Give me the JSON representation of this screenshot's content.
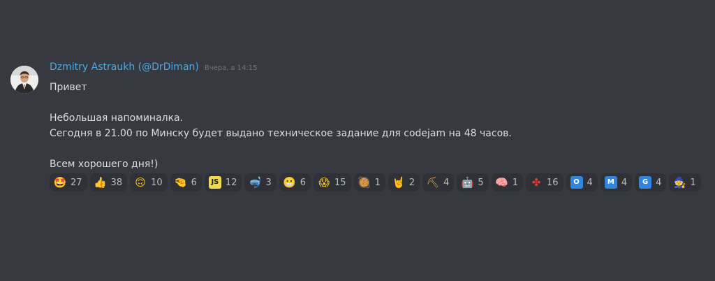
{
  "message": {
    "author": "Dzmitry Astraukh (@DrDiman)",
    "timestamp": "Вчера, в 14:15",
    "lines": [
      "Привет",
      "",
      "Небольшая напоминалка.",
      "Сегодня в 21.00 по Минску будет выдано техническое задание для codejam на 48 часов.",
      "",
      "Всем хорошего дня!)"
    ]
  },
  "reactions": [
    {
      "name": "star-struck",
      "glyph": "🤩",
      "count": "27",
      "bg": "transparent",
      "color": "#f7c72b"
    },
    {
      "name": "thumbs-up",
      "glyph": "👍",
      "count": "38",
      "bg": "transparent",
      "color": "#f7c72b"
    },
    {
      "name": "upside-down-face",
      "glyph": "🙃",
      "count": "10",
      "bg": "transparent",
      "color": "#f7c72b"
    },
    {
      "name": "pinching-hand",
      "glyph": "🤏",
      "count": "6",
      "bg": "transparent",
      "color": "#f7c72b"
    },
    {
      "name": "js",
      "glyph": "JS",
      "count": "12",
      "bg": "#f0db4f",
      "color": "#222"
    },
    {
      "name": "snorkel",
      "glyph": "🤿",
      "count": "3",
      "bg": "transparent",
      "color": "#4fa8e0"
    },
    {
      "name": "grimacing",
      "glyph": "😬",
      "count": "6",
      "bg": "transparent",
      "color": "#f7c72b"
    },
    {
      "name": "scream",
      "glyph": "😱",
      "count": "15",
      "bg": "transparent",
      "color": "#f7c72b"
    },
    {
      "name": "bowl",
      "glyph": "🥘",
      "count": "1",
      "bg": "transparent",
      "color": "#c0392b"
    },
    {
      "name": "rock-on",
      "glyph": "🤘",
      "count": "2",
      "bg": "transparent",
      "color": "#f7c72b"
    },
    {
      "name": "shovel",
      "glyph": "⛏",
      "count": "4",
      "bg": "transparent",
      "color": "#d4a23a"
    },
    {
      "name": "robot",
      "glyph": "🤖",
      "count": "5",
      "bg": "transparent",
      "color": "#7f8fa6"
    },
    {
      "name": "brain",
      "glyph": "🧠",
      "count": "1",
      "bg": "transparent",
      "color": "#e8a0b0"
    },
    {
      "name": "fan",
      "glyph": "✤",
      "count": "16",
      "bg": "transparent",
      "color": "#e03c31"
    },
    {
      "name": "letter-o",
      "glyph": "O",
      "count": "4",
      "bg": "#2e86de",
      "color": "#fff"
    },
    {
      "name": "letter-m",
      "glyph": "M",
      "count": "4",
      "bg": "#2e86de",
      "color": "#fff"
    },
    {
      "name": "letter-g",
      "glyph": "G",
      "count": "4",
      "bg": "#2e86de",
      "color": "#fff"
    },
    {
      "name": "mage",
      "glyph": "🧙",
      "count": "1",
      "bg": "transparent",
      "color": "#8e44ad"
    }
  ]
}
